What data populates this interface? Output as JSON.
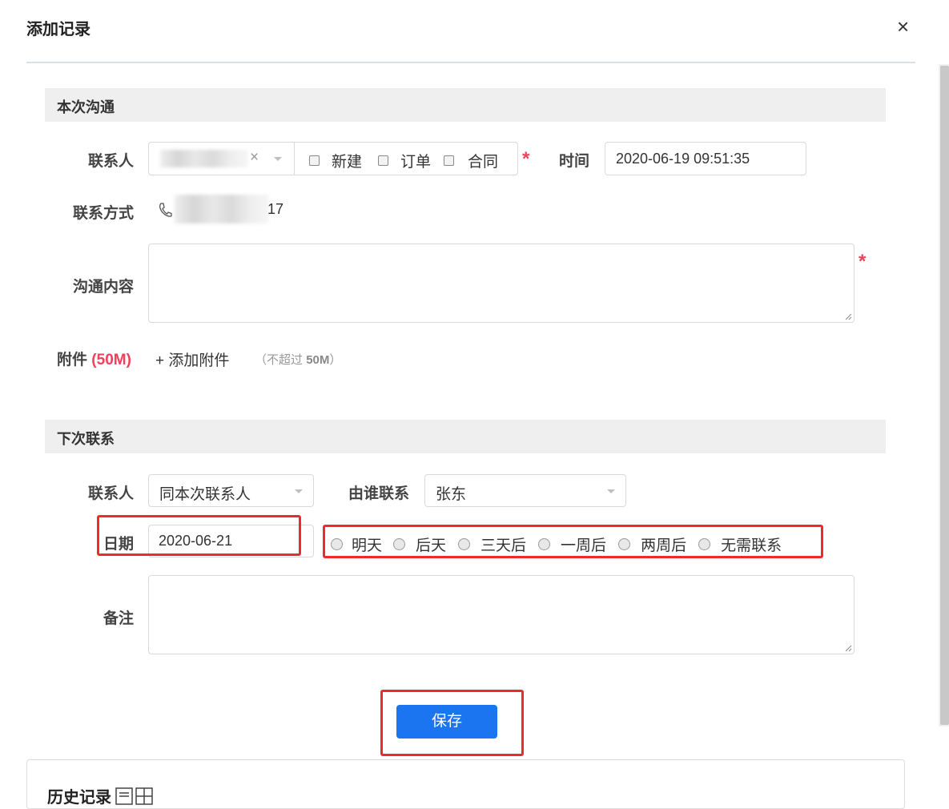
{
  "dialog": {
    "title": "添加记录",
    "close_icon": "×"
  },
  "section_current": {
    "title": "本次沟通",
    "contact_label": "联系人",
    "contact_clear": "×",
    "checkboxes": [
      "新建",
      "订单",
      "合同"
    ],
    "required_mark": "*",
    "time_label": "时间",
    "time_value": "2020-06-19 09:51:35",
    "contact_method_label": "联系方式",
    "phone_suffix": "17",
    "content_label": "沟通内容",
    "attachment_label": "附件",
    "attachment_size": "(50M)",
    "add_attachment": "+ 添加附件",
    "attachment_hint_prefix": "（不超过",
    "attachment_hint_size": "50M",
    "attachment_hint_suffix": "）"
  },
  "section_next": {
    "title": "下次联系",
    "contact_label": "联系人",
    "contact_value": "同本次联系人",
    "by_label": "由谁联系",
    "by_value": "张东",
    "date_label": "日期",
    "date_value": "2020-06-21",
    "quick_options": [
      "明天",
      "后天",
      "三天后",
      "一周后",
      "两周后",
      "无需联系"
    ],
    "remark_label": "备注"
  },
  "actions": {
    "save_label": "保存"
  },
  "history": {
    "title": "历史记录"
  },
  "colors": {
    "accent": "#1b74f0",
    "required": "#f0405c",
    "highlight": "#f02a2a"
  }
}
